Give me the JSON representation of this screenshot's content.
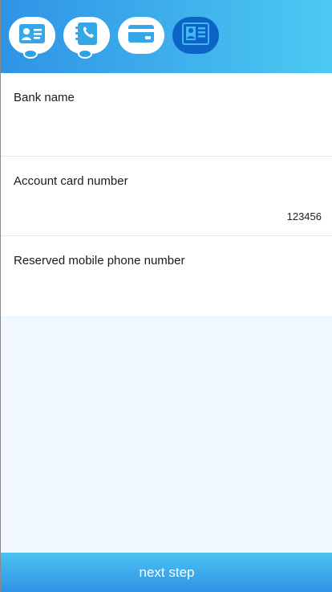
{
  "steps": [
    {
      "icon": "id-card-icon",
      "active": false
    },
    {
      "icon": "phone-book-icon",
      "active": false
    },
    {
      "icon": "bank-card-icon",
      "active": false
    },
    {
      "icon": "profile-card-icon",
      "active": true
    }
  ],
  "form": {
    "bank_name": {
      "label": "Bank name",
      "value": ""
    },
    "account_card_number": {
      "label": "Account card number",
      "value": "123456"
    },
    "reserved_mobile": {
      "label": "Reserved mobile phone number",
      "value": ""
    }
  },
  "footer": {
    "next_label": "next step"
  },
  "colors": {
    "header_start": "#2f93e6",
    "header_end": "#4cc9f2",
    "active_step": "#0c64c7",
    "page_background": "#f1f7fe"
  }
}
